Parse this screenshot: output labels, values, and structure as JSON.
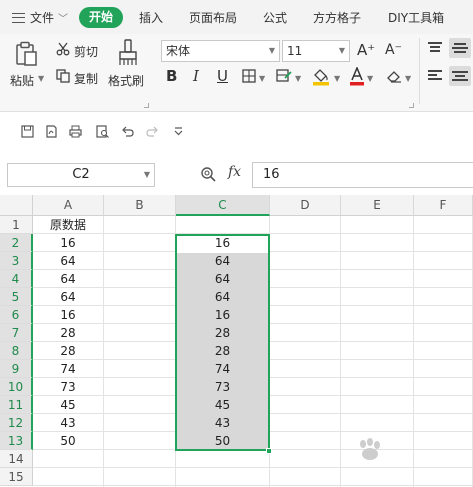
{
  "menu": {
    "file_label": "文件",
    "start_label": "开始",
    "insert_label": "插入",
    "layout_label": "页面布局",
    "formula_label": "公式",
    "grid_label": "方方格子",
    "diy_label": "DIY工具箱"
  },
  "ribbon": {
    "paste_label": "粘贴",
    "cut_label": "剪切",
    "copy_label": "复制",
    "format_painter_label": "格式刷",
    "font_name": "宋体",
    "font_size": "11",
    "grow_font": "A⁺",
    "shrink_font": "A⁻",
    "bold": "B",
    "italic": "I",
    "underline": "U",
    "font_color_letter": "A",
    "font_color_hex": "#e02020",
    "fill_color_hex": "#f5c400"
  },
  "formula_bar": {
    "name_box": "C2",
    "fx": "fx",
    "value": "16"
  },
  "columns": [
    "A",
    "B",
    "C",
    "D",
    "E",
    "F"
  ],
  "rows": [
    "1",
    "2",
    "3",
    "4",
    "5",
    "6",
    "7",
    "8",
    "9",
    "10",
    "11",
    "12",
    "13",
    "14",
    "15"
  ],
  "sheet": {
    "a_header": "原数据",
    "col_a": [
      "16",
      "64",
      "64",
      "64",
      "16",
      "28",
      "28",
      "74",
      "73",
      "45",
      "43",
      "50"
    ],
    "col_c": [
      "16",
      "64",
      "64",
      "64",
      "16",
      "28",
      "28",
      "74",
      "73",
      "45",
      "43",
      "50"
    ]
  },
  "colors": {
    "accent": "#21a35a",
    "selection_fill": "#d8d8d8"
  }
}
